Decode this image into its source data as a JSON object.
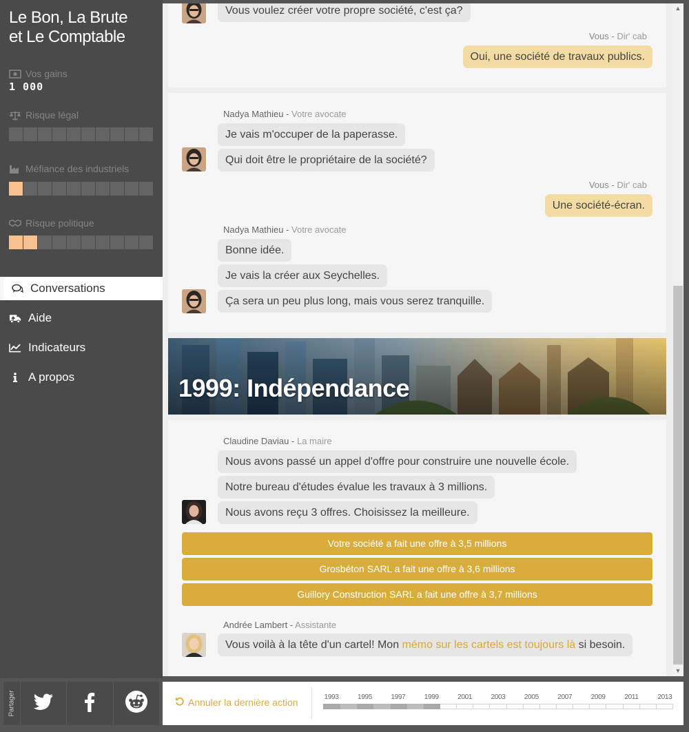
{
  "app": {
    "title_line1": "Le Bon, La Brute",
    "title_line2": "et Le Comptable"
  },
  "stats": {
    "gains_label": "Vos gains",
    "gains_value": "1 000",
    "legal_label": "Risque légal",
    "legal_level": 0,
    "industry_label": "Méfiance des industriels",
    "industry_level": 1,
    "political_label": "Risque politique",
    "political_level": 2,
    "meter_max": 10,
    "meter_color": "#f7c28f"
  },
  "nav": [
    {
      "label": "Conversations",
      "icon": "chat-bubbles-icon",
      "active": true
    },
    {
      "label": "Aide",
      "icon": "ambulance-icon",
      "active": false
    },
    {
      "label": "Indicateurs",
      "icon": "line-chart-icon",
      "active": false
    },
    {
      "label": "A propos",
      "icon": "info-icon",
      "active": false
    }
  ],
  "chat": {
    "card1": {
      "msg_top": "Vous voulez créer votre propre société, c'est ça?",
      "me_name": "Vous",
      "me_role": "Dir' cab",
      "me_msg": "Oui, une société de travaux publics."
    },
    "card2": {
      "speaker1_name": "Nadya Mathieu",
      "speaker1_role": "Votre avocate",
      "msg1": "Je vais m'occuper de la paperasse.",
      "msg2": "Qui doit être le propriétaire de la société?",
      "me_name": "Vous",
      "me_role": "Dir' cab",
      "me_msg": "Une société-écran.",
      "speaker2_name": "Nadya Mathieu",
      "speaker2_role": "Votre avocate",
      "msg3": "Bonne idée.",
      "msg4": "Je vais la créer aux Seychelles.",
      "msg5": "Ça sera un peu plus long, mais vous serez tranquille."
    },
    "banner_title": "1999: Indépendance",
    "card3": {
      "speaker_name": "Claudine Daviau",
      "speaker_role": "La maire",
      "msg1": "Nous avons passé un appel d'offre pour construire une nouvelle école.",
      "msg2": "Notre bureau d'études évalue les travaux à 3 millions.",
      "msg3": "Nous avons reçu 3 offres. Choisissez la meilleure.",
      "choices": [
        "Votre société a fait une offre à 3,5 millions",
        "Grosbéton SARL a fait une offre à 3,6 millions",
        "Guillory Construction SARL a fait une offre à 3,7 millions"
      ],
      "assistant_name": "Andrée Lambert",
      "assistant_role": "Assistante",
      "assistant_msg_before": "Vous voilà à la tête d'un cartel! Mon ",
      "assistant_link": "mémo sur les cartels est toujours là",
      "assistant_msg_after": " si besoin."
    }
  },
  "share": {
    "label": "Partager",
    "buttons": [
      "twitter-icon",
      "facebook-icon",
      "reddit-icon"
    ]
  },
  "timeline": {
    "undo_label": "Annuler la dernière action",
    "years": [
      "1993",
      "1995",
      "1997",
      "1999",
      "2001",
      "2003",
      "2005",
      "2007",
      "2009",
      "2011",
      "2013"
    ],
    "cells": 21,
    "progress_cells": 7
  },
  "colors": {
    "accent": "#d8ad3c",
    "me_bubble": "#f2dca3",
    "sidebar": "#4a4a4a"
  }
}
